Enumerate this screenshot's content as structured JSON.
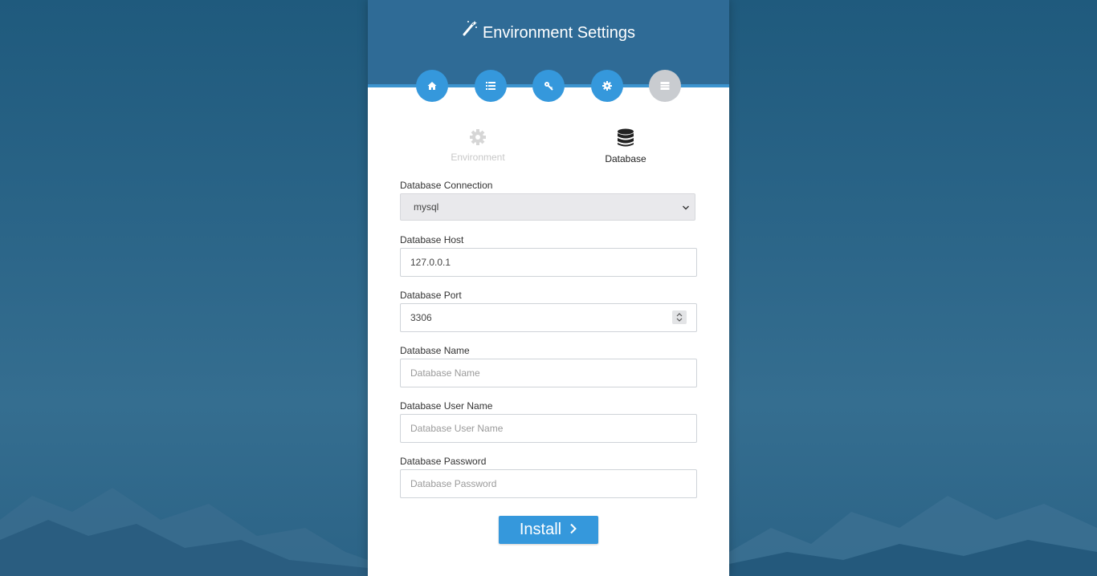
{
  "header": {
    "title": "Environment Settings",
    "title_icon": "magic-wand-icon"
  },
  "steps": [
    {
      "icon": "home-icon",
      "state": "done"
    },
    {
      "icon": "list-icon",
      "state": "done"
    },
    {
      "icon": "key-icon",
      "state": "done"
    },
    {
      "icon": "gear-icon",
      "state": "done"
    },
    {
      "icon": "server-icon",
      "state": "inactive"
    }
  ],
  "tabs": {
    "environment": {
      "label": "Environment",
      "icon": "gear-icon",
      "active": false
    },
    "database": {
      "label": "Database",
      "icon": "database-icon",
      "active": true
    }
  },
  "form": {
    "connection": {
      "label": "Database Connection",
      "value": "mysql"
    },
    "host": {
      "label": "Database Host",
      "value": "127.0.0.1"
    },
    "port": {
      "label": "Database Port",
      "value": "3306"
    },
    "name": {
      "label": "Database Name",
      "placeholder": "Database Name"
    },
    "user": {
      "label": "Database User Name",
      "placeholder": "Database User Name"
    },
    "password": {
      "label": "Database Password",
      "placeholder": "Database Password"
    }
  },
  "install_button": {
    "label": "Install"
  },
  "colors": {
    "header": "#2f6b96",
    "accent": "#3598dc",
    "inactive_step": "#c9ccd0"
  }
}
